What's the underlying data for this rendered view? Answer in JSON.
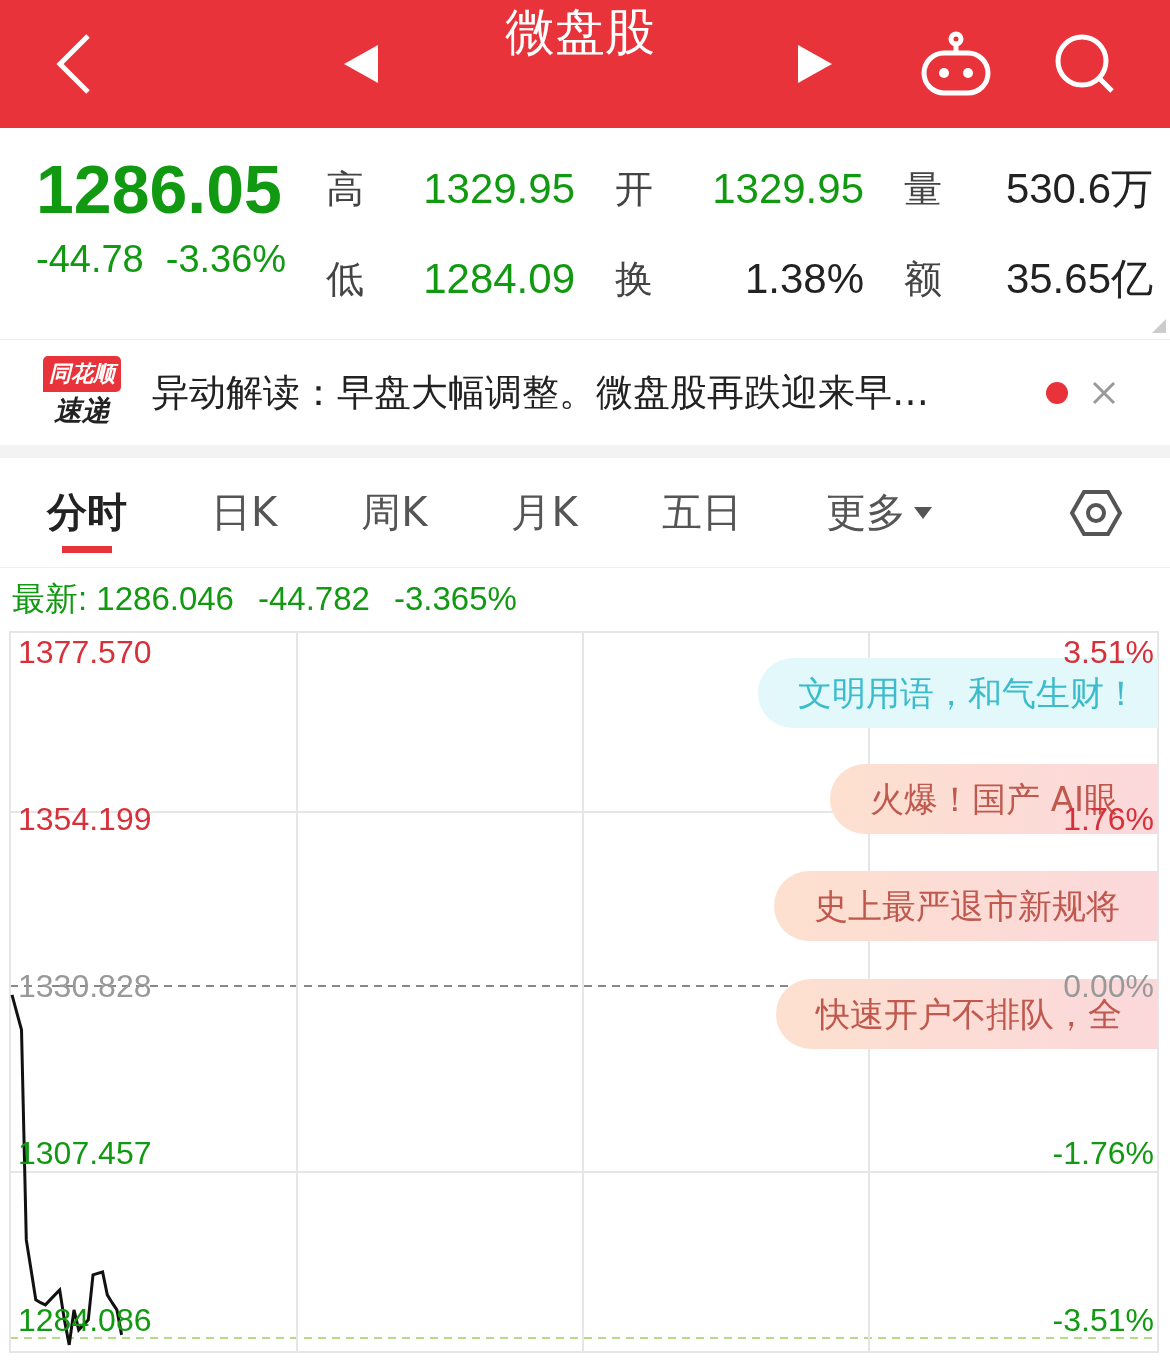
{
  "header": {
    "title": "微盘股"
  },
  "quote": {
    "price": "1286.05",
    "change": "-44.78",
    "change_pct": "-3.36%",
    "stats": [
      {
        "label": "高",
        "value": "1329.95",
        "color": "#119911"
      },
      {
        "label": "开",
        "value": "1329.95",
        "color": "#119911"
      },
      {
        "label": "量",
        "value": "530.6万",
        "color": "#222222"
      },
      {
        "label": "低",
        "value": "1284.09",
        "color": "#119911"
      },
      {
        "label": "换",
        "value": "1.38%",
        "color": "#222222"
      },
      {
        "label": "额",
        "value": "35.65亿",
        "color": "#222222"
      }
    ]
  },
  "news": {
    "logo_top": "同花顺",
    "logo_bottom": "速递",
    "headline": "异动解读：早盘大幅调整。微盘股再跌迎来早…",
    "unread": true
  },
  "tabs": [
    {
      "label": "分时",
      "selected": true
    },
    {
      "label": "日K",
      "selected": false
    },
    {
      "label": "周K",
      "selected": false
    },
    {
      "label": "月K",
      "selected": false
    },
    {
      "label": "五日",
      "selected": false
    },
    {
      "label": "更多",
      "selected": false,
      "kind": "menu"
    }
  ],
  "latest": {
    "label": "最新: 1286.046",
    "change": "-44.782",
    "change_pct": "-3.365%"
  },
  "chart": {
    "pct_labels": [
      {
        "text": "3.51%",
        "color": "#d8303a"
      },
      {
        "text": "1.76%",
        "color": "#d8303a"
      },
      {
        "text": "0.00%",
        "color": "#999999"
      },
      {
        "text": "-1.76%",
        "color": "#119911"
      },
      {
        "text": "-3.51%",
        "color": "#119911"
      }
    ],
    "bubbles": [
      {
        "text": "文明用语，和气生财！",
        "kind": "cyan"
      },
      {
        "text": "火爆！国产 AI眼",
        "kind": "peach"
      },
      {
        "text": "史上最严退市新规将",
        "kind": "peach"
      },
      {
        "text": "快速开户不排队，全",
        "kind": "peach"
      }
    ],
    "chart_data": {
      "type": "line",
      "categories": [
        null,
        null,
        null,
        null,
        null,
        null,
        null,
        null,
        null,
        null,
        null,
        null,
        null,
        null,
        null,
        null,
        null,
        null,
        null,
        null,
        null,
        null,
        null,
        null,
        null,
        null,
        null,
        null,
        null,
        null,
        null,
        null,
        null,
        null,
        null,
        null,
        null,
        null,
        null,
        null,
        null,
        null,
        null,
        null,
        null,
        null,
        null,
        null,
        null,
        null,
        null,
        null,
        null,
        null,
        null,
        null,
        null,
        null,
        null,
        null,
        null,
        null,
        null,
        null,
        null,
        null,
        null,
        null,
        null,
        null,
        null,
        null,
        null,
        null,
        null,
        null,
        null,
        null,
        null,
        null,
        null,
        null,
        null,
        null,
        null,
        null,
        null,
        null,
        null,
        null,
        null,
        null,
        null,
        null,
        null,
        null,
        null,
        null,
        null,
        null,
        null,
        null,
        null,
        null,
        null,
        null,
        null,
        null,
        null,
        null,
        null,
        null,
        null,
        null,
        null,
        null,
        null,
        null,
        null,
        null,
        null,
        null,
        null,
        null,
        null,
        null,
        null,
        null,
        null,
        null,
        null,
        null,
        null,
        null,
        null,
        null,
        null,
        null,
        null,
        null,
        null,
        null,
        null,
        null,
        null,
        null,
        null,
        null,
        null,
        null,
        null,
        null,
        null,
        null,
        null,
        null,
        null,
        null,
        null,
        null,
        null,
        null,
        null,
        null,
        null,
        null,
        null,
        null,
        null,
        null,
        null,
        null,
        null,
        null,
        null,
        null,
        null,
        null,
        null,
        null,
        null,
        null,
        null,
        null,
        null,
        null,
        null,
        null,
        null,
        null,
        null,
        null,
        null,
        null,
        null,
        null,
        null,
        null,
        null,
        null,
        null,
        null,
        null,
        null,
        null,
        null,
        null,
        null,
        null,
        null,
        null,
        null,
        null,
        null,
        null,
        null,
        null,
        null,
        null,
        null,
        null,
        null,
        null,
        null,
        null,
        null,
        null,
        null,
        null,
        null,
        null,
        null,
        null,
        null,
        null,
        null,
        null,
        null,
        null,
        null,
        null
      ],
      "ylim": [
        1279.605,
        1380.37
      ],
      "yticks": [
        {
          "value": 1377.57,
          "label": "1377.570"
        },
        {
          "value": 1354.199,
          "label": "1354.199"
        },
        {
          "value": 1330.828,
          "label": "1330.828"
        },
        {
          "value": 1307.457,
          "label": "1307.457"
        },
        {
          "value": 1284.086,
          "label": "1284.086"
        }
      ],
      "series": [
        {
          "color": "#111111",
          "values": [
            1329.6,
            1327.1,
            1324.7,
            1295.3,
            1291.1,
            1286.9,
            1286.5,
            1286.2,
            1286.9,
            1287.6,
            1288.3,
            1284.1,
            1280.6,
            1285.5,
            1282.7,
            1283.4,
            1284.1,
            1290.4,
            1290.6,
            1290.8,
            1287.6,
            1286.5,
            1285.5,
            1282.0,
            null,
            null,
            null,
            null,
            null,
            null,
            null,
            null,
            null,
            null,
            null,
            null,
            null,
            null,
            null,
            null,
            null,
            null,
            null,
            null,
            null,
            null,
            null,
            null,
            null,
            null,
            null,
            null,
            null,
            null,
            null,
            null,
            null,
            null,
            null,
            null,
            null,
            null,
            null,
            null,
            null,
            null,
            null,
            null,
            null,
            null,
            null,
            null,
            null,
            null,
            null,
            null,
            null,
            null,
            null,
            null,
            null,
            null,
            null,
            null,
            null,
            null,
            null,
            null,
            null,
            null,
            null,
            null,
            null,
            null,
            null,
            null,
            null,
            null,
            null,
            null,
            null,
            null,
            null,
            null,
            null,
            null,
            null,
            null,
            null,
            null,
            null,
            null,
            null,
            null,
            null,
            null,
            null,
            null,
            null,
            null,
            null,
            null,
            null,
            null,
            null,
            null,
            null,
            null,
            null,
            null,
            null,
            null,
            null,
            null,
            null,
            null,
            null,
            null,
            null,
            null,
            null,
            null,
            null,
            null,
            null,
            null,
            null,
            null,
            null,
            null,
            null,
            null,
            null,
            null,
            null,
            null,
            null,
            null,
            null,
            null,
            null,
            null,
            null,
            null,
            null,
            null,
            null,
            null,
            null,
            null,
            null,
            null,
            null,
            null,
            null,
            null,
            null,
            null,
            null,
            null,
            null,
            null,
            null,
            null,
            null,
            null,
            null,
            null,
            null,
            null,
            null,
            null,
            null,
            null,
            null,
            null,
            null,
            null,
            null,
            null,
            null,
            null,
            null,
            null,
            null,
            null,
            null,
            null,
            null,
            null,
            null,
            null,
            null,
            null,
            null,
            null,
            null,
            null,
            null,
            null,
            null,
            null,
            null,
            null,
            null,
            null,
            null,
            null,
            null,
            null,
            null,
            null,
            null,
            null,
            null,
            null,
            null,
            null,
            null,
            null,
            null
          ]
        }
      ]
    }
  }
}
